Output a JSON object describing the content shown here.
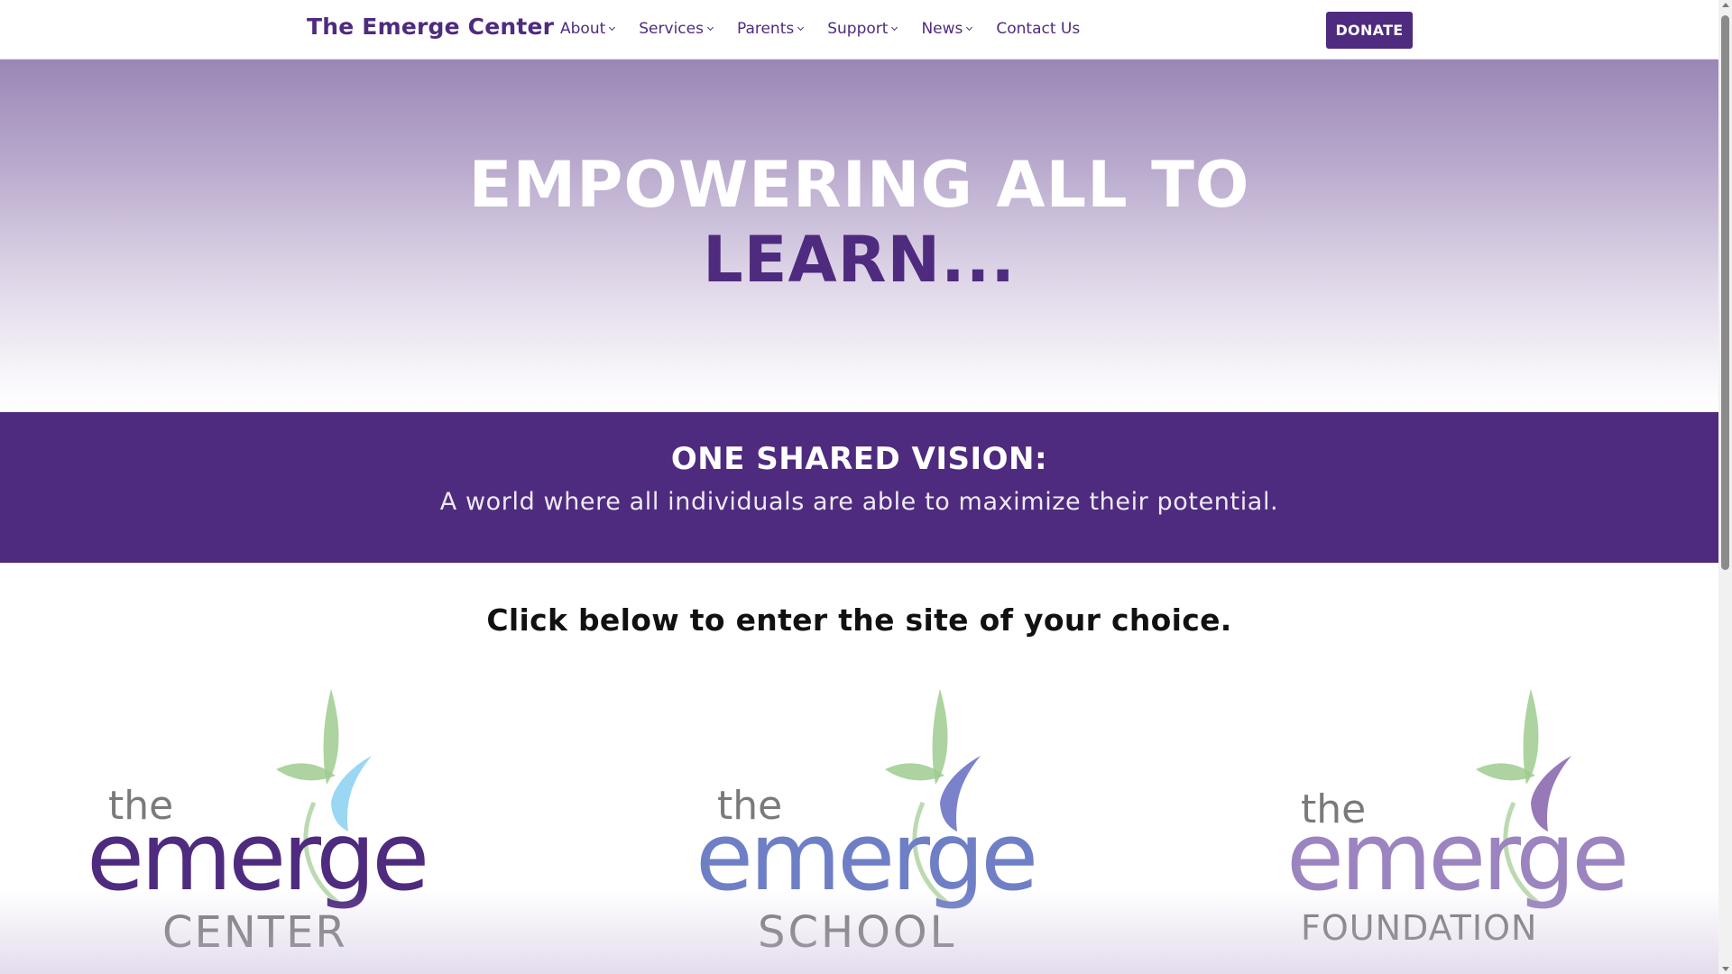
{
  "header": {
    "brand": "The Emerge Center",
    "nav": [
      {
        "label": "About",
        "dropdown": true
      },
      {
        "label": "Services",
        "dropdown": true
      },
      {
        "label": "Parents",
        "dropdown": true
      },
      {
        "label": "Support",
        "dropdown": true
      },
      {
        "label": "News",
        "dropdown": true
      },
      {
        "label": "Contact Us",
        "dropdown": false
      }
    ],
    "donate_label": "DONATE"
  },
  "hero": {
    "line1": "EMPOWERING ALL TO",
    "line2": "LEARN..."
  },
  "vision": {
    "title": "ONE SHARED VISION:",
    "text": "A world where all individuals are able to maximize their potential."
  },
  "choice": {
    "heading": "Click below to enter the site of your choice.",
    "logos": [
      {
        "the": "the",
        "word": "emerge",
        "sub": "CENTER"
      },
      {
        "the": "the",
        "word": "emerge",
        "sub": "SCHOOL"
      },
      {
        "the": "the",
        "word": "emerge",
        "sub": "FOUNDATION"
      }
    ]
  },
  "colors": {
    "brand_purple": "#4e2b7e",
    "school_blue": "#6f7fc6",
    "foundation_lavender": "#9b84bf",
    "leaf_green": "#9fcb8f",
    "center_leaf": "#8fd3f2",
    "school_leaf": "#6a74c4",
    "foundation_leaf": "#8c6ab0"
  }
}
